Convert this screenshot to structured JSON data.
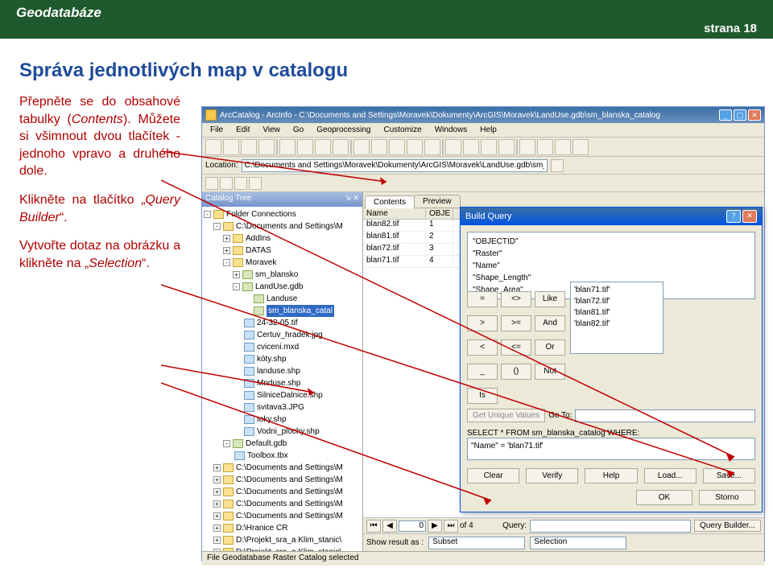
{
  "header": {
    "left": "Geodatabáze",
    "right": "strana 18"
  },
  "title": "Správa jednotlivých map v catalogu",
  "para1_a": "Přepněte se do obsahové tabulky (",
  "para1_b": "Contents",
  "para1_c": "). Můžete si všimnout dvou tlačítek - jednoho vpravo a druhého dole.",
  "para2_a": "Klikněte na tlačítko „",
  "para2_b": "Query Builder",
  "para2_c": "“.",
  "para3_a": "Vytvořte dotaz na obrázku a klikněte na „",
  "para3_b": "Selection",
  "para3_c": "“.",
  "win": {
    "title": "ArcCatalog - ArcInfo - C:\\Documents and Settings\\Moravek\\Dokumenty\\ArcGIS\\Moravek\\LandUse.gdb\\sm_blanska_catalog",
    "menu": [
      "File",
      "Edit",
      "View",
      "Go",
      "Geoprocessing",
      "Customize",
      "Windows",
      "Help"
    ],
    "loc_label": "Location:",
    "loc_value": "C:\\Documents and Settings\\Moravek\\Dokumenty\\ArcGIS\\Moravek\\LandUse.gdb\\sm_bla",
    "tree_title": "Catalog Tree",
    "tabs": [
      "Contents",
      "Preview"
    ],
    "status": "File Geodatabase Raster Catalog selected",
    "table": {
      "cols": [
        "Name",
        "OBJE"
      ],
      "rows": [
        [
          "blan82.tif",
          "1"
        ],
        [
          "blan81.tif",
          "2"
        ],
        [
          "blan72.tif",
          "3"
        ],
        [
          "blan71.tif",
          "4"
        ]
      ]
    },
    "nav": {
      "val": "0",
      "of": "of 4"
    },
    "show_label": "Show result as :",
    "show_opts": [
      "Subset",
      "Selection"
    ],
    "qb_label": "Query:",
    "qb_btn": "Query Builder...",
    "tree": [
      {
        "ind": 0,
        "exp": "-",
        "t": "Folder Connections",
        "ic": "fico"
      },
      {
        "ind": 1,
        "exp": "-",
        "t": "C:\\Documents and Settings\\M",
        "ic": "fico"
      },
      {
        "ind": 2,
        "exp": "+",
        "t": "AddIns",
        "ic": "fico"
      },
      {
        "ind": 2,
        "exp": "+",
        "t": "DATAS",
        "ic": "fico"
      },
      {
        "ind": 2,
        "exp": "-",
        "t": "Moravek",
        "ic": "fico"
      },
      {
        "ind": 3,
        "exp": "+",
        "t": "sm_blansko",
        "ic": "gico"
      },
      {
        "ind": 3,
        "exp": "-",
        "t": "LandUse.gdb",
        "ic": "gico"
      },
      {
        "ind": 4,
        "exp": "",
        "t": "Landuse",
        "ic": "gico"
      },
      {
        "ind": 4,
        "exp": "",
        "t": "sm_blanska_catal",
        "ic": "gico",
        "hl": true
      },
      {
        "ind": 3,
        "exp": "",
        "t": "24-32-05.tif",
        "ic": "sico"
      },
      {
        "ind": 3,
        "exp": "",
        "t": "Certuv_hradek.jpg",
        "ic": "sico"
      },
      {
        "ind": 3,
        "exp": "",
        "t": "cviceni.mxd",
        "ic": "sico"
      },
      {
        "ind": 3,
        "exp": "",
        "t": "kóty.shp",
        "ic": "sico"
      },
      {
        "ind": 3,
        "exp": "",
        "t": "landuse.shp",
        "ic": "sico"
      },
      {
        "ind": 3,
        "exp": "",
        "t": "Mnduse.shp",
        "ic": "sico"
      },
      {
        "ind": 3,
        "exp": "",
        "t": "SilniceDalnice.shp",
        "ic": "sico"
      },
      {
        "ind": 3,
        "exp": "",
        "t": "svitava3.JPG",
        "ic": "sico"
      },
      {
        "ind": 3,
        "exp": "",
        "t": "toky.shp",
        "ic": "sico"
      },
      {
        "ind": 3,
        "exp": "",
        "t": "Vodni_plochy.shp",
        "ic": "sico"
      },
      {
        "ind": 2,
        "exp": "-",
        "t": "Default.gdb",
        "ic": "gico"
      },
      {
        "ind": 2,
        "exp": "",
        "t": "Toolbox.tbx",
        "ic": "sico"
      },
      {
        "ind": 1,
        "exp": "+",
        "t": "C:\\Documents and Settings\\M",
        "ic": "fico"
      },
      {
        "ind": 1,
        "exp": "+",
        "t": "C:\\Documents and Settings\\M",
        "ic": "fico"
      },
      {
        "ind": 1,
        "exp": "+",
        "t": "C:\\Documents and Settings\\M",
        "ic": "fico"
      },
      {
        "ind": 1,
        "exp": "+",
        "t": "C:\\Documents and Settings\\M",
        "ic": "fico"
      },
      {
        "ind": 1,
        "exp": "+",
        "t": "C:\\Documents and Settings\\M",
        "ic": "fico"
      },
      {
        "ind": 1,
        "exp": "+",
        "t": "D:\\Hranice CR",
        "ic": "fico"
      },
      {
        "ind": 1,
        "exp": "+",
        "t": "D:\\Projekt_sra_a Klim_stanic\\",
        "ic": "fico"
      },
      {
        "ind": 1,
        "exp": "+",
        "t": "D:\\Projekt_sra_a Klim_stanic\\",
        "ic": "fico"
      }
    ]
  },
  "bq": {
    "title": "Build Query",
    "fields": [
      "\"OBJECTID\"",
      "\"Raster\"",
      "\"Name\"",
      "\"Shape_Length\"",
      "\"Shape_Area\""
    ],
    "ops": [
      [
        "=",
        "<>",
        "Like"
      ],
      [
        ">",
        ">=",
        "And"
      ],
      [
        "<",
        "<=",
        "Or"
      ],
      [
        "_",
        "()",
        "Not"
      ],
      [
        "Is",
        "",
        ""
      ]
    ],
    "vals": [
      "'blan71.tif'",
      "'blan72.tif'",
      "'blan81.tif'",
      "'blan82.tif'"
    ],
    "uv": "Get Unique Values",
    "goto": "Go To:",
    "sel_label": "SELECT * FROM sm_blanska_catalog WHERE:",
    "where": "\"Name\" = 'blan71.tif'",
    "btns1": [
      "Clear",
      "Verify",
      "Help",
      "Load...",
      "Save..."
    ],
    "btns2": [
      "OK",
      "Storno"
    ]
  }
}
